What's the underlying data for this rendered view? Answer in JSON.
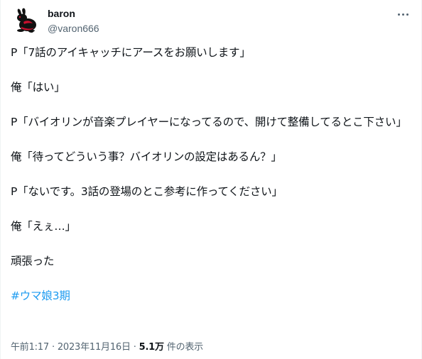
{
  "user": {
    "display_name": "baron",
    "handle": "@varon666",
    "avatar_icon": "rabbit-silhouette-icon",
    "avatar_color": "#c8102e"
  },
  "more_icon": "ellipsis-icon",
  "tweet": {
    "paragraphs": [
      "P「7話のアイキャッチにアースをお願いします」",
      "俺「はい」",
      "P「バイオリンが音楽プレイヤーになってるので、開けて整備してるとこ下さい」",
      "俺「待ってどういう事？バイオリンの設定はあるん？」",
      "P「ないです。3話の登場のとこ参考に作ってください」",
      "俺「えぇ…」",
      "頑張った"
    ],
    "hashtag": "#ウマ娘3期",
    "hashtag_color": "#1d9bf0"
  },
  "meta": {
    "time": "午前1:17",
    "separator": "·",
    "date": "2023年11月16日",
    "views_count": "5.1万",
    "views_label": "件の表示"
  }
}
